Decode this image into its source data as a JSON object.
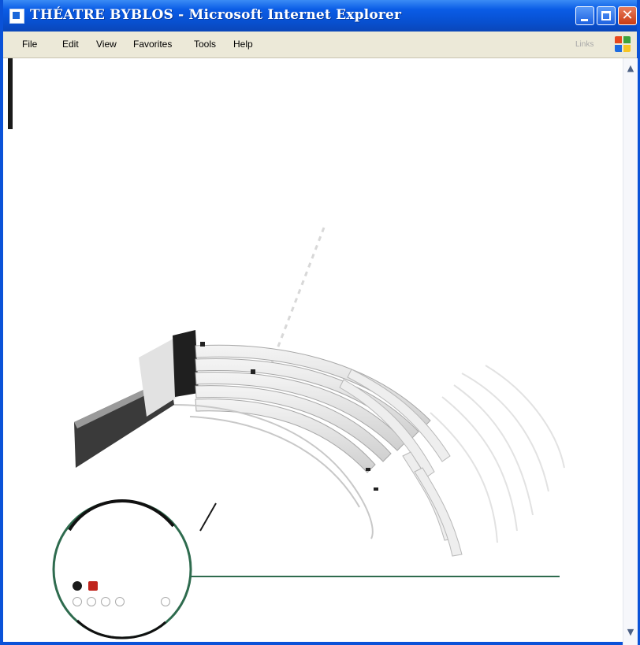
{
  "window": {
    "title": "THÉATRE BYBLOS - Microsoft Internet Explorer",
    "close_glyph": "✕"
  },
  "menu": [
    {
      "label": "File"
    },
    {
      "label": "Edit"
    },
    {
      "label": "View"
    },
    {
      "label": "Favorites"
    },
    {
      "label": "Tools"
    },
    {
      "label": "Help"
    }
  ],
  "toolbar": {
    "links_label": "Links"
  },
  "navigation": {
    "active_colors": [
      "#1a1a1a",
      "#c0241c"
    ],
    "empty_dots": 5
  },
  "colors": {
    "accent_green": "#2e6b4e",
    "accent_red": "#c0241c",
    "titlebar_blue": "#0a5ce6"
  },
  "icons": {
    "window": "ie-page-icon",
    "minimize": "minimize-icon",
    "maximize": "maximize-icon",
    "close": "close-icon",
    "logo": "windows-logo-icon",
    "scroll_up": "chevron-up-icon",
    "scroll_down": "chevron-down-icon"
  }
}
